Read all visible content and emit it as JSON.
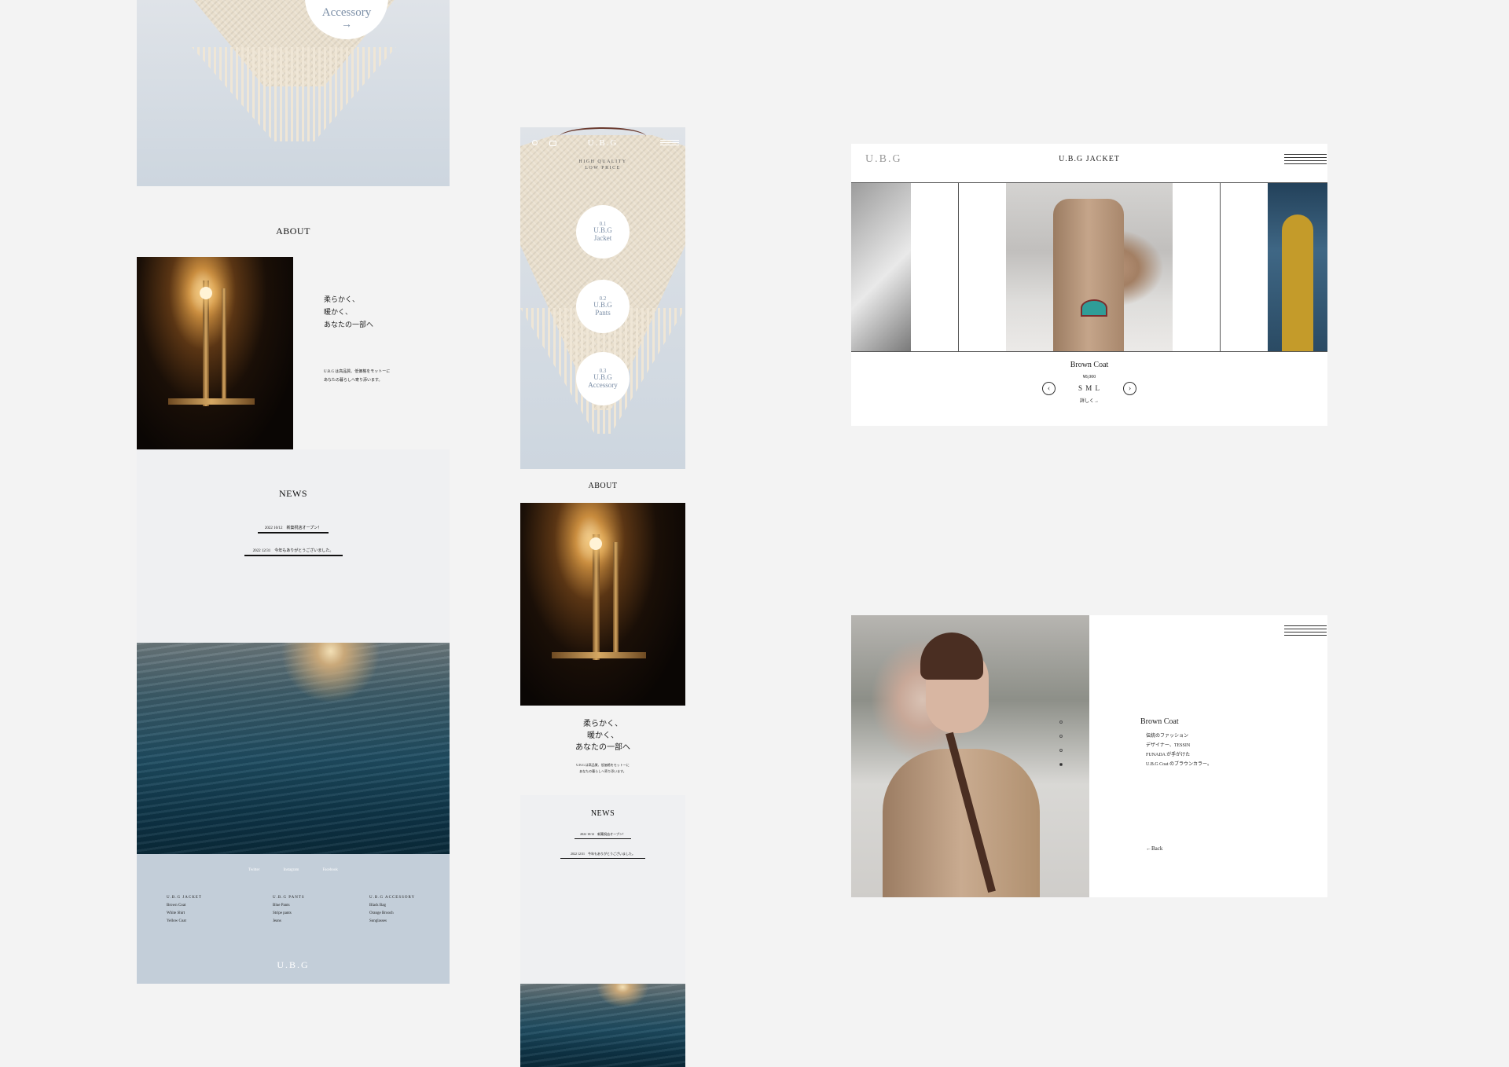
{
  "desktop_home": {
    "hero": {
      "category_label": "Accessory",
      "arrow": "→"
    },
    "about": {
      "title": "ABOUT",
      "headline": [
        "柔らかく、",
        "暖かく、",
        "あなたの一部へ"
      ],
      "body": [
        "U.B.G は高品質、低価格をモットーに",
        "あなたの暮らしへ寄り添います。"
      ]
    },
    "news": {
      "title": "NEWS",
      "items": [
        "2022 10/12　新築祝店オープン！",
        "2022 12/31　今年もありがとうございました。"
      ]
    },
    "footer": {
      "social": [
        "Twitter",
        "Instagram",
        "Facebook"
      ],
      "columns": [
        {
          "heading": "U.B.G JACKET",
          "items": [
            "Brown Coat",
            "White Shirt",
            "Yellow Coat"
          ]
        },
        {
          "heading": "U.B.G PANTS",
          "items": [
            "Blue Pants",
            "Stripe pants",
            "Jeans"
          ]
        },
        {
          "heading": "U.B.G ACCESSORY",
          "items": [
            "Black Bag",
            "Orange Brooch",
            "Sunglasses"
          ]
        }
      ],
      "logo": "U.B.G"
    }
  },
  "mobile_home": {
    "logo": "U.B.G",
    "tagline": [
      "HIGH QUALITY",
      "LOW PRICE"
    ],
    "categories": [
      {
        "number": "0.1",
        "brand": "U.B.G",
        "name": "Jacket"
      },
      {
        "number": "0.2",
        "brand": "U.B.G",
        "name": "Pants"
      },
      {
        "number": "0.3",
        "brand": "U.B.G",
        "name": "Accessory"
      }
    ],
    "about": {
      "title": "ABOUT",
      "headline": [
        "柔らかく、",
        "暖かく、",
        "あなたの一部へ"
      ],
      "body": [
        "U.B.G は高品質、低価格をモットーに",
        "あなたの暮らしへ寄り添います。"
      ]
    },
    "news": {
      "title": "NEWS",
      "items": [
        "2022 10/12　新築祝店オープン！",
        "2022 12/31　今年もありがとうございました。"
      ]
    }
  },
  "jacket_carousel": {
    "logo": "U.B.G",
    "title": "U.B.G JACKET",
    "product_name": "Brown Coat",
    "price": "¥8,000",
    "sizes": "S M L",
    "detail_link": "詳しく→",
    "prev_icon": "‹",
    "next_icon": "›"
  },
  "product_detail": {
    "name": "Brown Coat",
    "description": [
      "伝統のファッション",
      "デザイナー、TESSIN",
      "FUNADA が手がけた",
      "U.B.G Coat のブラウンカラー。"
    ],
    "back_link": "←Back",
    "slide_count": 4,
    "active_slide": 4
  },
  "colors": {
    "page_bg": "#f3f3f3",
    "accent_blue": "#7b8ea6",
    "footer_bg": "#c3ced9",
    "news_bg": "#eff0f2"
  }
}
